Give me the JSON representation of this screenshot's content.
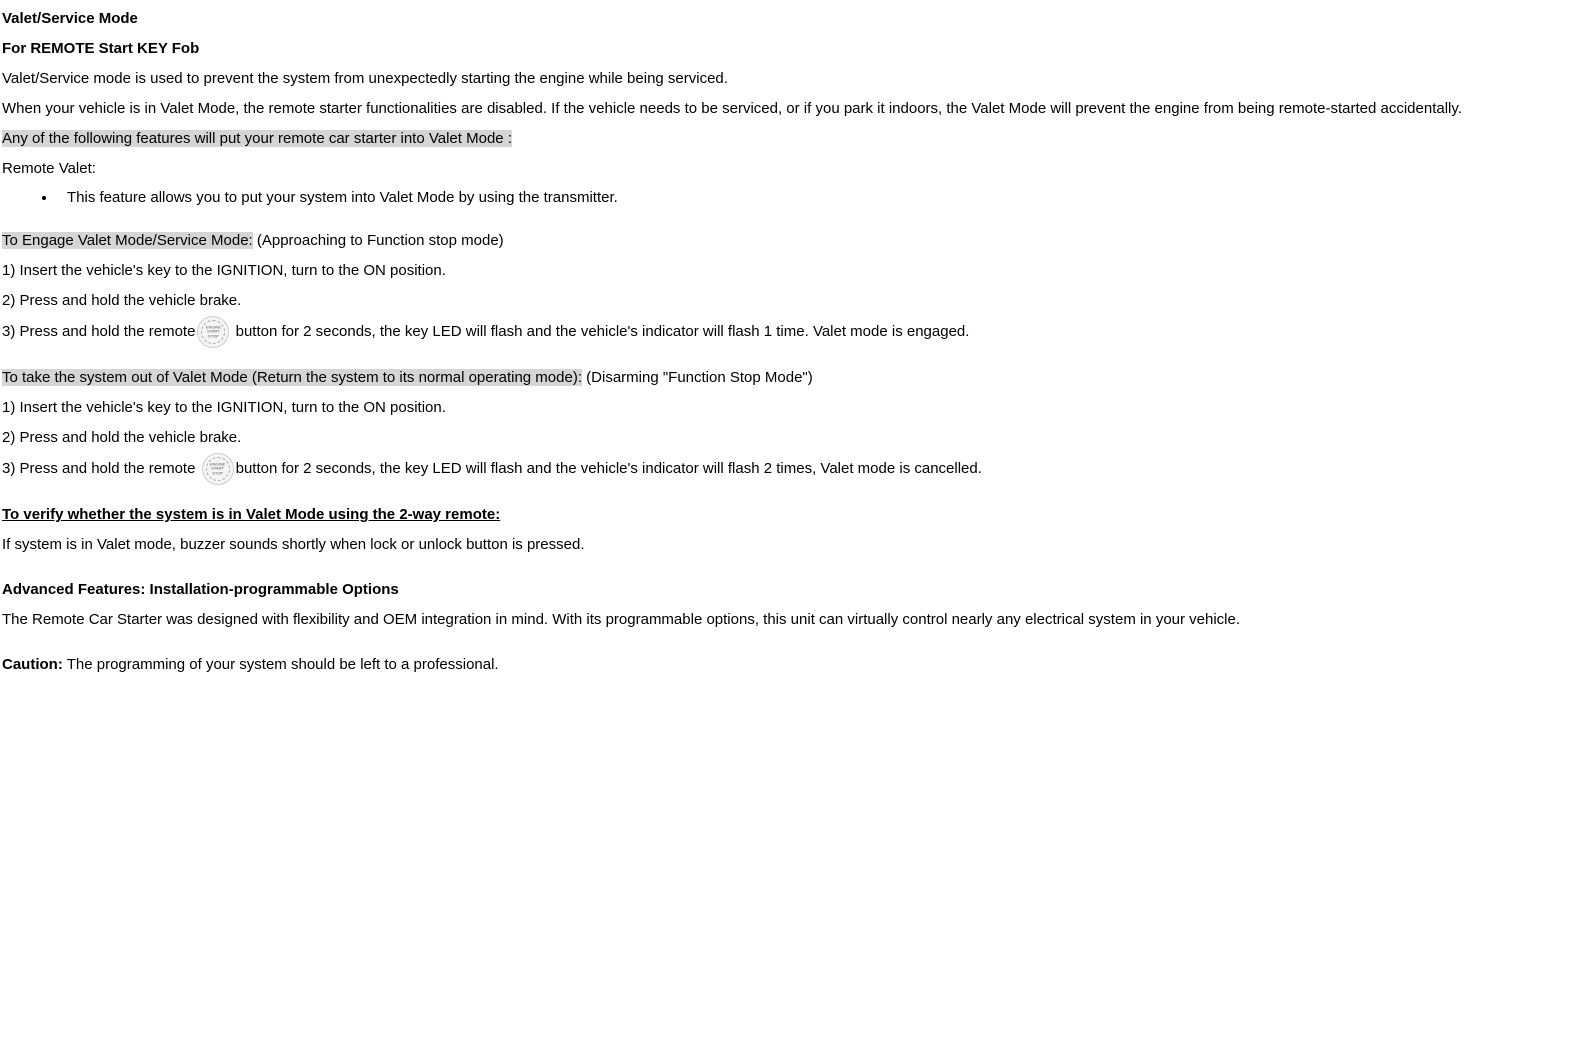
{
  "title1": "Valet/Service Mode",
  "title2": "For REMOTE Start KEY Fob",
  "p1": "Valet/Service mode is used to prevent the system from unexpectedly starting the engine while being serviced.",
  "p2": "When your vehicle is in Valet Mode, the remote starter functionalities are disabled. If the vehicle needs to be serviced, or if you park it indoors, the Valet Mode will prevent the engine from being remote-started accidentally.",
  "hl1": "Any of the following features will put your remote car starter into Valet Mode :",
  "rvLabel": "Remote Valet:",
  "bullet1": "This feature allows you to put your system into Valet Mode by using the transmitter.",
  "engageHl": "To Engage Valet Mode/Service Mode:",
  "engageSuffix": " (Approaching to Function stop mode)",
  "engageStep1": "1) Insert the vehicle's key to the IGNITION, turn to the ON position.",
  "engageStep2": "2) Press and hold the vehicle brake.",
  "engageStep3a": "3) Press and hold the remote",
  "engageStep3b": " button for 2 seconds, the key LED will flash and the vehicle's indicator will flash 1 time. Valet mode is engaged.",
  "takeoutHl": "To take the system out of Valet Mode (Return the system to its normal operating mode):",
  "takeoutSuffix": " (Disarming \"Function Stop Mode\")",
  "takeoutStep1": "1) Insert the vehicle's key to the IGNITION, turn to the ON position.",
  "takeoutStep2": "2) Press and hold the vehicle brake.",
  "takeoutStep3a": "3) Press and hold the remote ",
  "takeoutStep3b": "button for 2 seconds, the key LED will flash and the vehicle's indicator will flash 2 times, Valet mode is cancelled.",
  "verifyTitle": "To verify whether the system is in Valet Mode using the 2-way remote:",
  "verifyText": "If system is in Valet mode, buzzer sounds shortly when lock or unlock button is pressed.",
  "advTitle": "Advanced Features: Installation-programmable Options",
  "advText": "The Remote Car Starter was designed with flexibility and OEM integration in mind. With its programmable options, this unit can virtually control nearly any electrical system in your vehicle.",
  "cautionLabel": "Caution:",
  "cautionText": " The programming of your system should be left to a professional."
}
